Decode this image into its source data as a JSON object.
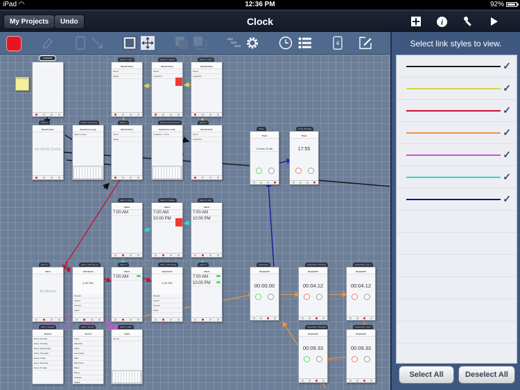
{
  "status_bar": {
    "device": "iPad",
    "time": "12:36 PM",
    "battery": "92%"
  },
  "nav": {
    "my_projects_label": "My Projects",
    "undo_label": "Undo",
    "title": "Clock",
    "right_icons": [
      "add-icon",
      "info-icon",
      "wrench-icon",
      "play-icon"
    ]
  },
  "toolbar": {
    "tools": [
      "color-swatch",
      "eraser-icon",
      "device-icon",
      "link-arrow-icon",
      "fit-screen-icon",
      "move-icon",
      "bring-front-icon",
      "send-back-icon",
      "hierarchy-icon",
      "gear-icon",
      "clock-icon",
      "list-icon",
      "device-count-icon",
      "edit-icon"
    ],
    "color_swatch": "#e5161f",
    "device_count": "4"
  },
  "canvas": {
    "launch_label": "Launch",
    "note_text": "iPhone Clock App",
    "screens": [
      {
        "id": "launch",
        "tag": "",
        "title": "",
        "kind": "blank"
      },
      {
        "id": "wc-edit",
        "tag": "World C. Edit",
        "title": "World Clock",
        "kind": "list",
        "rows": [
          "Seoul",
          "Today"
        ]
      },
      {
        "id": "wc-delete",
        "tag": "World C. Delete",
        "title": "World Clock",
        "kind": "delete",
        "rows": [
          "Seoul",
          "Cupertino"
        ]
      },
      {
        "id": "wc-edit2",
        "tag": "World C. Edit",
        "title": "World Clock",
        "kind": "list",
        "rows": [
          "Seoul",
          "Cupertino"
        ]
      },
      {
        "id": "world1",
        "tag": "World 1",
        "title": "World Clock",
        "kind": "empty",
        "empty_text": "No World Clocks"
      },
      {
        "id": "add-seoul",
        "tag": "World: Add Seoul",
        "title": "Search for a city",
        "kind": "keyboard",
        "rows": [
          "Seoul, Korea"
        ]
      },
      {
        "id": "world1b",
        "tag": "World 1",
        "title": "World Clock",
        "kind": "list",
        "rows": [
          "Seoul",
          "Today"
        ]
      },
      {
        "id": "add-cupertino",
        "tag": "World: Add Cupertino",
        "title": "Search for a city",
        "kind": "keyboard",
        "rows": [
          "Cupertino, U.S.A."
        ]
      },
      {
        "id": "world2",
        "tag": "World 2",
        "title": "World Clock",
        "kind": "list",
        "rows": [
          "Seoul",
          "Cupertino"
        ]
      },
      {
        "id": "timer",
        "tag": "Timer",
        "title": "Timer",
        "kind": "timer",
        "value": "0 Hours  15 min"
      },
      {
        "id": "timer-working",
        "tag": "Timer Working",
        "title": "Timer",
        "kind": "big",
        "value": "17:55"
      },
      {
        "id": "alarm1-edit",
        "tag": "Alarm 1: Edit",
        "title": "Alarm",
        "kind": "alarm",
        "rows": [
          "7:00 AM"
        ]
      },
      {
        "id": "alarm2-delete",
        "tag": "Alarm 2: Delete",
        "title": "Alarm",
        "kind": "alarm-delete",
        "rows": [
          "7:00 AM",
          "10:00 PM"
        ]
      },
      {
        "id": "alarm2-edit",
        "tag": "Alarm 2: Edit",
        "title": "Alarm",
        "kind": "alarm",
        "rows": [
          "7:00 AM",
          "10:00 PM"
        ]
      },
      {
        "id": "alarm0",
        "tag": "Alarm 0",
        "title": "Alarm",
        "kind": "empty",
        "empty_text": "No Alarms"
      },
      {
        "id": "add-getup",
        "tag": "Alarm: Add Get up",
        "title": "Add Alarm",
        "kind": "picker",
        "rows": [
          "Repeat",
          "Sound",
          "Snooze",
          "Label"
        ]
      },
      {
        "id": "alarm1",
        "tag": "Alarm 1",
        "title": "Alarm",
        "kind": "alarm-toggle",
        "rows": [
          "7:00 AM"
        ]
      },
      {
        "id": "add-sleep",
        "tag": "Alarm: Add Sleep",
        "title": "Add Alarm",
        "kind": "picker",
        "rows": [
          "Repeat",
          "Sound",
          "Snooze",
          "Label"
        ]
      },
      {
        "id": "alarm2",
        "tag": "Alarm 2",
        "title": "Alarm",
        "kind": "alarm-toggle",
        "rows": [
          "7:00 AM",
          "10:00 PM"
        ]
      },
      {
        "id": "repeat",
        "tag": "Alarm: Repeat",
        "title": "Repeat",
        "kind": "rows",
        "rows": [
          "Every Monday",
          "Every Tuesday",
          "Every Wednesday",
          "Every Thursday",
          "Every Friday",
          "Every Saturday",
          "Every Sunday"
        ]
      },
      {
        "id": "sound",
        "tag": "Alarm: Sound",
        "title": "Sound",
        "kind": "rows",
        "rows": [
          "None",
          "Marimba",
          "Alarm",
          "Ascending",
          "Bark",
          "Bell Tower",
          "Blues",
          "Boing",
          "Crickets",
          "Digital",
          "Doorbell"
        ]
      },
      {
        "id": "label",
        "tag": "Alarm: Label",
        "title": "Label",
        "kind": "keyboard",
        "rows": [
          "Get up"
        ]
      },
      {
        "id": "stopwatch",
        "tag": "Stopwatch",
        "title": "Stopwatch",
        "kind": "stopwatch",
        "value": "00:00.00"
      },
      {
        "id": "sw-working",
        "tag": "Stopwatch: Working",
        "title": "Stopwatch",
        "kind": "stopwatch",
        "value": "00:04.12"
      },
      {
        "id": "sw-lap1",
        "tag": "Stopwatch: Lap 1",
        "title": "Stopwatch",
        "kind": "stopwatch",
        "value": "00:04.12"
      },
      {
        "id": "sw-stopped",
        "tag": "Stopwatch: Stopped",
        "title": "Stopwatch",
        "kind": "stopwatch",
        "value": "00:09.33"
      },
      {
        "id": "sw-lap2",
        "tag": "Stopwatch: Lap 2",
        "title": "Stopwatch",
        "kind": "stopwatch",
        "value": "00:09.33"
      }
    ]
  },
  "panel": {
    "header": "Select link styles to view.",
    "link_styles": [
      {
        "name": "black",
        "color": "#1a1a1a",
        "checked": true
      },
      {
        "name": "yellow",
        "color": "#d6d64a",
        "checked": true
      },
      {
        "name": "red",
        "color": "#c8102e",
        "checked": true
      },
      {
        "name": "orange",
        "color": "#f0923a",
        "checked": true
      },
      {
        "name": "magenta",
        "color": "#d24fd6",
        "checked": true
      },
      {
        "name": "cyan",
        "color": "#3fcfd0",
        "checked": true
      },
      {
        "name": "navy",
        "color": "#11129a",
        "checked": true
      }
    ],
    "check_glyph": "✓",
    "select_all_label": "Select All",
    "deselect_all_label": "Deselect All"
  }
}
